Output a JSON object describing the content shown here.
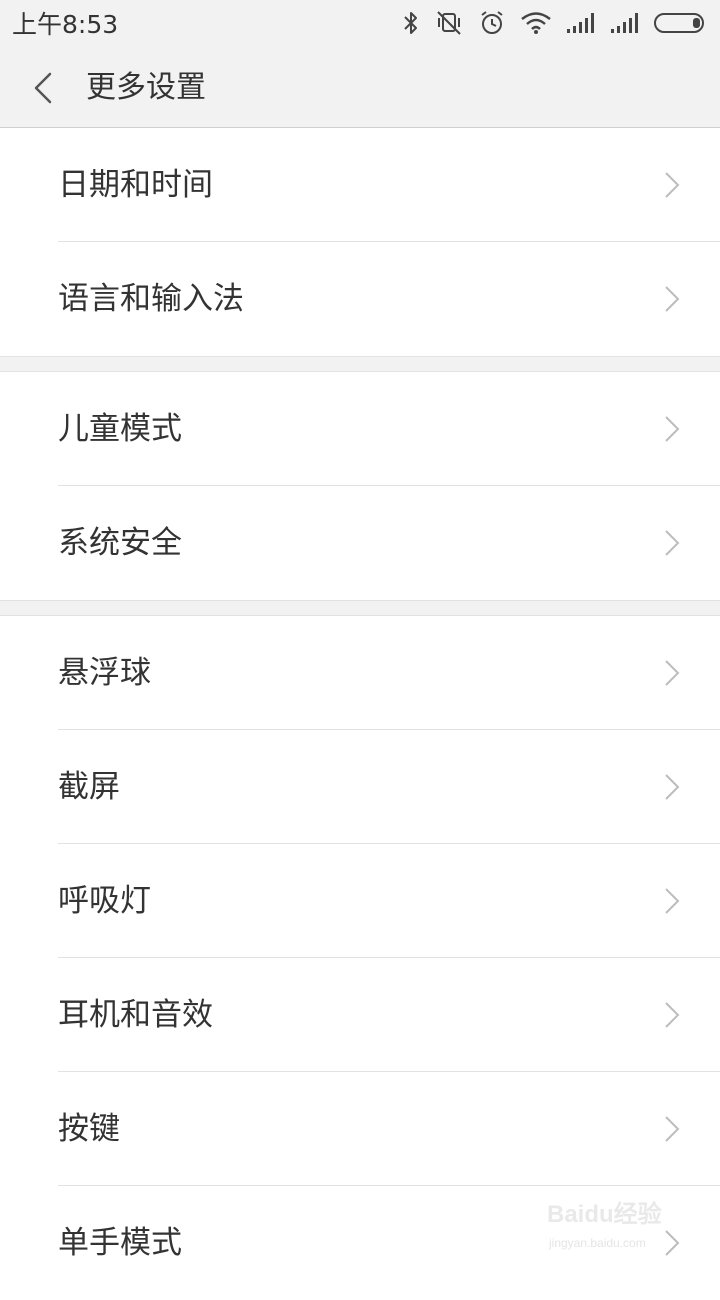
{
  "status_bar": {
    "time": "上午8:53",
    "icons": [
      "bluetooth-icon",
      "vibrate-off-icon",
      "alarm-icon",
      "wifi-icon",
      "signal-icon",
      "signal-icon",
      "battery-icon"
    ]
  },
  "header": {
    "title": "更多设置"
  },
  "groups": [
    {
      "items": [
        {
          "label": "日期和时间"
        },
        {
          "label": "语言和输入法"
        }
      ]
    },
    {
      "items": [
        {
          "label": "儿童模式"
        },
        {
          "label": "系统安全"
        }
      ]
    },
    {
      "items": [
        {
          "label": "悬浮球"
        },
        {
          "label": "截屏"
        },
        {
          "label": "呼吸灯"
        },
        {
          "label": "耳机和音效"
        },
        {
          "label": "按键"
        },
        {
          "label": "单手模式"
        }
      ]
    }
  ],
  "watermark": {
    "brand": "Baidu经验",
    "url": "jingyan.baidu.com"
  },
  "colors": {
    "background": "#ffffff",
    "header_bg": "#f2f2f2",
    "divider": "#e2e2e2",
    "text": "#333333",
    "chevron": "#bdbdbd"
  }
}
